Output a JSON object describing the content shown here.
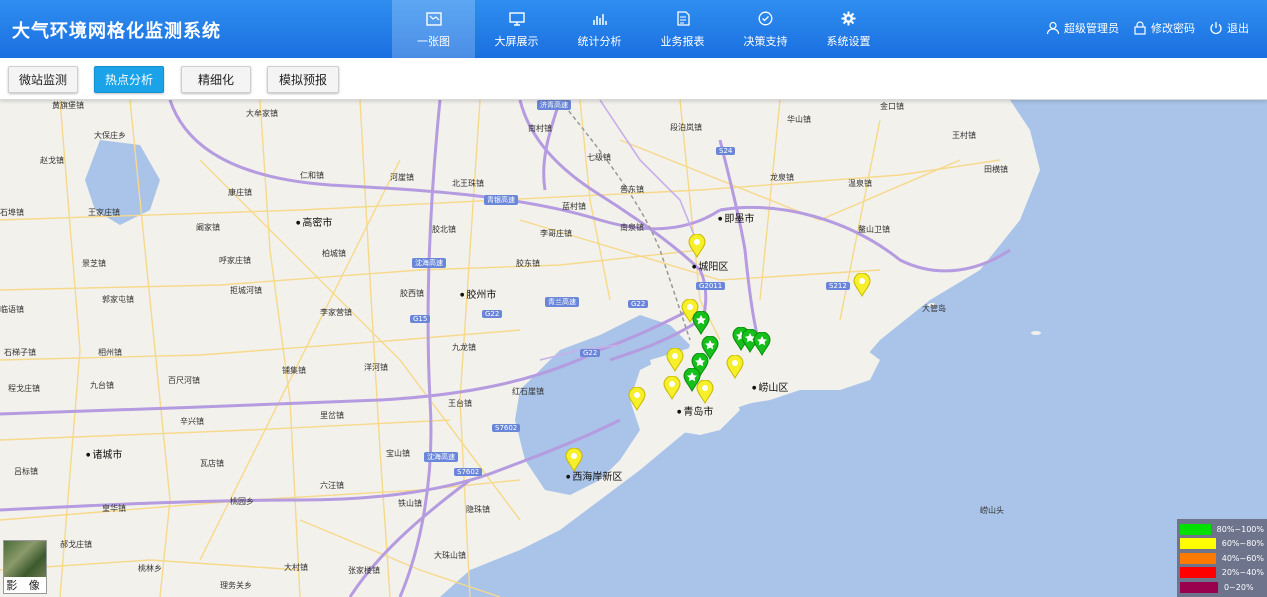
{
  "app": {
    "title": "大气环境网格化监测系统"
  },
  "nav": [
    {
      "label": "一张图",
      "icon": "map-icon",
      "active": true
    },
    {
      "label": "大屏展示",
      "icon": "monitor-icon",
      "active": false
    },
    {
      "label": "统计分析",
      "icon": "bar-chart-icon",
      "active": false
    },
    {
      "label": "业务报表",
      "icon": "report-icon",
      "active": false
    },
    {
      "label": "决策支持",
      "icon": "check-circle-icon",
      "active": false
    },
    {
      "label": "系统设置",
      "icon": "gear-icon",
      "active": false
    }
  ],
  "user": {
    "admin": "超级管理员",
    "change_password": "修改密码",
    "logout": "退出"
  },
  "toolbar": {
    "micro_station": "微站监测",
    "hotspot": "热点分析",
    "refine": "精细化",
    "simulation": "模拟预报"
  },
  "map": {
    "imagery_label": "影 像",
    "labels": {
      "l1": "黄旗堡镇",
      "l2": "大牟家镇",
      "l3": "大保庄乡",
      "l4": "南村镇",
      "l5": "段泊岚镇",
      "l6": "华山镇",
      "l7": "金口镇",
      "l8": "王村镇",
      "l9": "赵戈镇",
      "l10": "仁和镇",
      "l11": "河崖镇",
      "l12": "七级镇",
      "l13": "北王珠镇",
      "l14": "普东镇",
      "l15": "龙泉镇",
      "l16": "温泉镇",
      "l17": "田横镇",
      "l18": "康庄镇",
      "l19": "蓝村镇",
      "l20": "即墨市",
      "l21": "石埠镇",
      "l22": "王家庄镇",
      "l23": "高密市",
      "l24": "阚家镇",
      "l25": "胶北镇",
      "l26": "李哥庄镇",
      "l27": "南泉镇",
      "l28": "鳌山卫镇",
      "l29": "柏城镇",
      "l30": "胶东镇",
      "l31": "城阳区",
      "l32": "呼家庄镇",
      "l33": "景芝镇",
      "l34": "拒城河镇",
      "l35": "胶西镇",
      "l36": "胶州市",
      "l37": "郭家屯镇",
      "l38": "李家营镇",
      "l39": "临语镇",
      "l40": "九龙镇",
      "l41": "石梯子镇",
      "l42": "相州镇",
      "l43": "铺集镇",
      "l44": "洋河镇",
      "l45": "崂山区",
      "l46": "九台镇",
      "l47": "百尺河镇",
      "l48": "红石崖镇",
      "l49": "程戈庄镇",
      "l50": "王台镇",
      "l51": "里岔镇",
      "l52": "青岛市",
      "l53": "辛兴镇",
      "l54": "诸城市",
      "l55": "宝山镇",
      "l56": "吕标镇",
      "l57": "瓦店镇",
      "l58": "西海岸新区",
      "l59": "六汪镇",
      "l60": "桃园乡",
      "l61": "铁山镇",
      "l62": "皇华镇",
      "l63": "隐珠镇",
      "l64": "郝戈庄镇",
      "l65": "桃林乡",
      "l66": "大珠山镇",
      "l67": "大村镇",
      "l68": "张家楼镇",
      "l69": "理务关乡",
      "l70": "大管岛",
      "l71": "崂山头"
    },
    "roads": {
      "r1": "S24",
      "r2": "G2011",
      "r3": "G22",
      "r4": "G22",
      "r5": "G15",
      "r6": "G22",
      "r7": "S212",
      "r8": "S7602",
      "r9": "S7602",
      "r10": "青银高速",
      "r11": "济青高速",
      "r12": "青兰高速",
      "r13": "沈海高速",
      "r14": "沈海高速"
    }
  },
  "legend": [
    {
      "label": "80%~100%",
      "color": "#00e000"
    },
    {
      "label": "60%~80%",
      "color": "#ffff00"
    },
    {
      "label": "40%~60%",
      "color": "#ff7a00"
    },
    {
      "label": "20%~40%",
      "color": "#ff0000"
    },
    {
      "label": "0~20%",
      "color": "#99004d"
    }
  ],
  "colors": {
    "header": "#1a6fe0",
    "active_button": "#1aa3e8",
    "marker_green": "#16c01a",
    "marker_yellow": "#f5f02a",
    "sea": "#a9c4e8"
  }
}
